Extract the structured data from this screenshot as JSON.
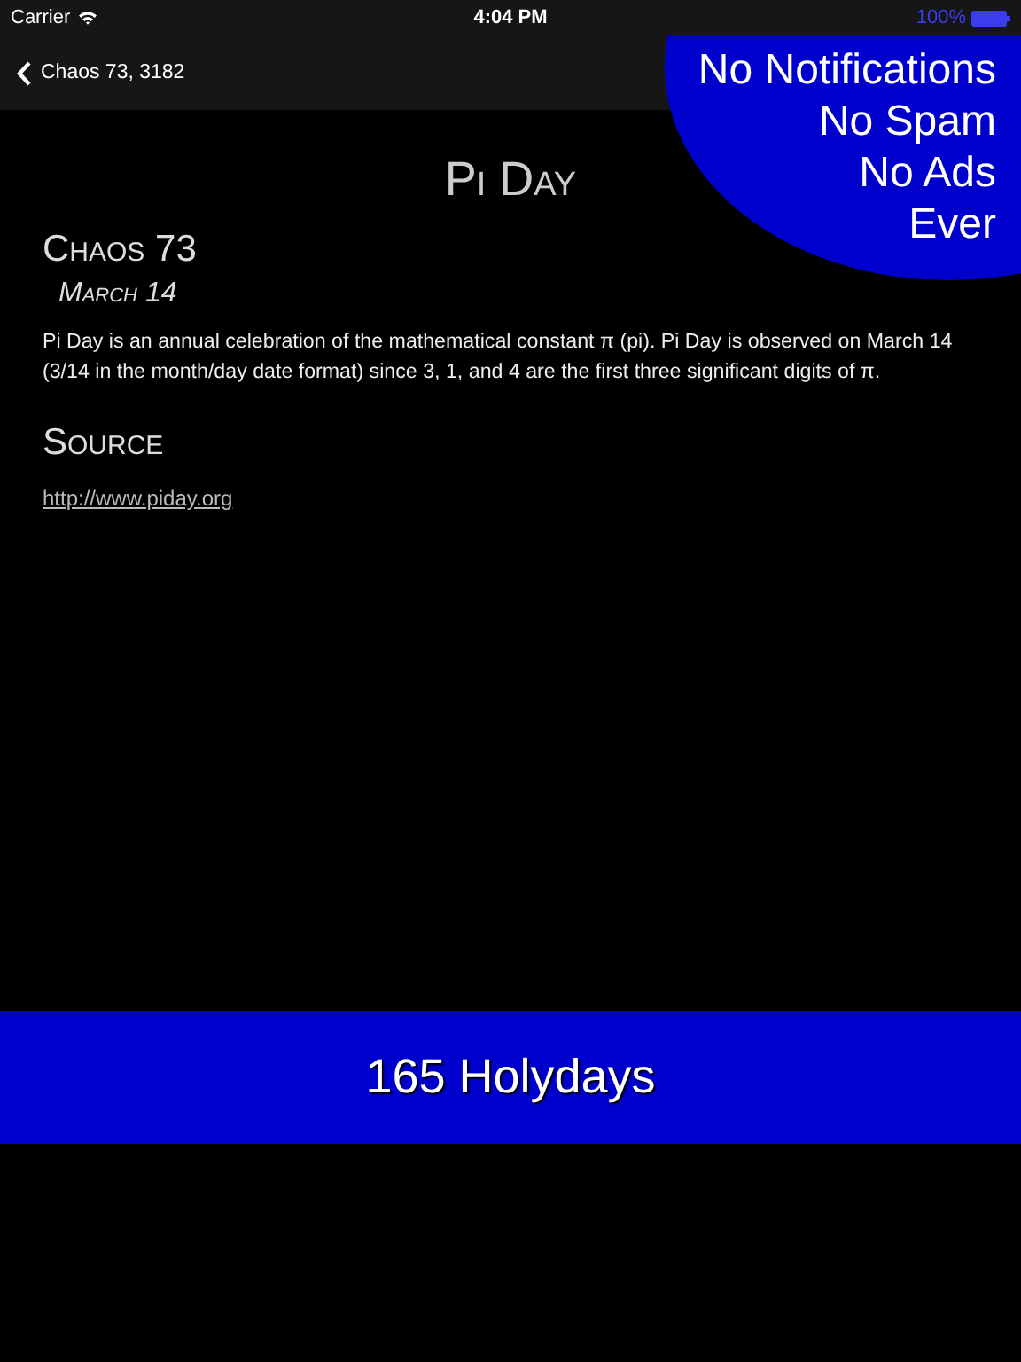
{
  "status_bar": {
    "carrier": "Carrier",
    "time": "4:04 PM",
    "battery": "100%"
  },
  "nav_bar": {
    "back": "Chaos 73, 3182"
  },
  "holiday": {
    "title": "Pi Day",
    "calendar": "Chaos 73",
    "date": "March 14",
    "description": "Pi Day is an annual celebration of the mathematical constant π (pi). Pi Day is observed on March 14 (3/14 in the month/day date format) since 3, 1, and 4 are the first three significant digits of π.",
    "source_heading": "Source",
    "source_link": "http://www.piday.org"
  },
  "promo": {
    "lines": [
      "No Notifications",
      "No Spam",
      "No Ads",
      "Ever"
    ]
  },
  "banner": {
    "text": "165 Holydays"
  }
}
